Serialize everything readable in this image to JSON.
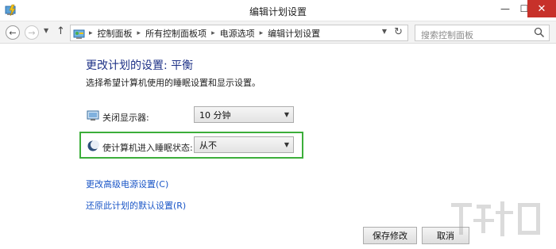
{
  "window": {
    "title": "编辑计划设置",
    "minimize": "—",
    "maximize": "☐",
    "close": "✕"
  },
  "nav": {
    "back": "←",
    "forward": "→",
    "dropdown": "▼",
    "up": "↑",
    "breadcrumbs": [
      "控制面板",
      "所有控制面板项",
      "电源选项",
      "编辑计划设置"
    ],
    "separator": "▸",
    "address_dropdown": "▼",
    "refresh": "↻",
    "search_placeholder": "搜索控制面板"
  },
  "content": {
    "heading": "更改计划的设置: 平衡",
    "subtext": "选择希望计算机使用的睡眠设置和显示设置。",
    "settings": [
      {
        "label": "关闭显示器:",
        "value": "10 分钟",
        "icon": "monitor-icon"
      },
      {
        "label": "使计算机进入睡眠状态:",
        "value": "从不",
        "icon": "moon-icon"
      }
    ],
    "select_arrow": "▼",
    "links": {
      "advanced": "更改高级电源设置(C)",
      "restore": "还原此计划的默认设置(R)"
    }
  },
  "buttons": {
    "save": "保存修改",
    "cancel": "取消"
  },
  "colors": {
    "heading": "#1e3287",
    "link": "#1a56c7",
    "highlight_border": "#3cae3a",
    "close_button": "#c7312a"
  }
}
